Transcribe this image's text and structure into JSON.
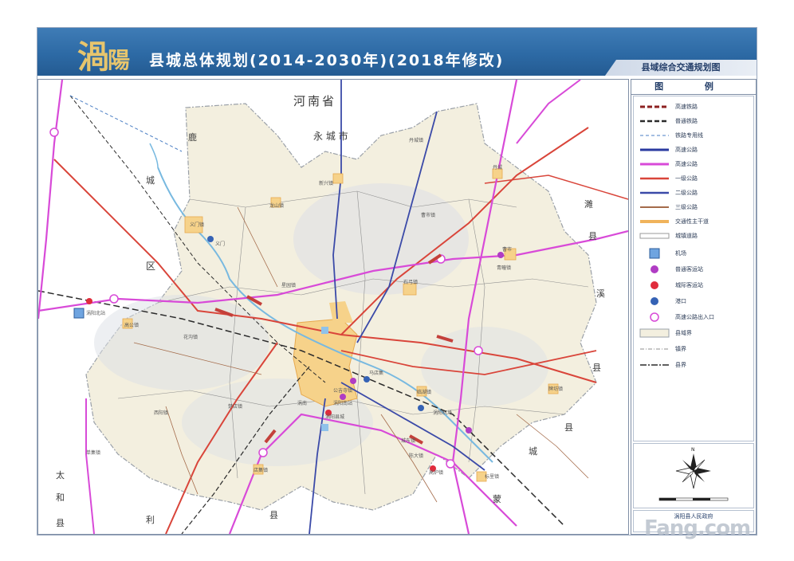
{
  "header": {
    "logo_big": "渦",
    "logo_small": "陽",
    "title": "县城总体规划(2014-2030年)(2018年修改)",
    "subtitle": "县域综合交通规划图"
  },
  "map": {
    "province_label": "河南省",
    "city_labels": {
      "yongcheng": "永 城 市",
      "left_region": "区",
      "right_region_1": "濉",
      "right_region_2": "溪",
      "right_region_3": "县",
      "bottom_left_1": "太",
      "bottom_left_2": "和",
      "bottom_left_3": "县",
      "bottom_1": "利",
      "bottom_2": "县",
      "bottom_right_1": "蒙",
      "bottom_right_2": "城",
      "bottom_right_3": "县",
      "top_left_1": "城",
      "top_left_2": "鹿",
      "top_right": "县"
    },
    "towns": {
      "t1": "丹城镇",
      "t2": "新兴镇",
      "t3": "龙山镇",
      "t4": "义门镇",
      "t5": "曹市镇",
      "t6": "青疃镇",
      "t7": "石弓镇",
      "t8": "花沟镇",
      "t9": "涡阳县城",
      "t10": "高公镇",
      "t11": "丹城",
      "t12": "临湖镇",
      "t13": "西阳镇",
      "t14": "单集镇",
      "t15": "店集镇",
      "t16": "牌坊镇",
      "t17": "标里镇",
      "t18": "公吉寺镇",
      "t19": "楚店镇",
      "t20": "陈大镇",
      "t21": "义门",
      "t22": "涡阳北站",
      "t23": "涡阳南站",
      "t24": "高炉镇",
      "t25": "曹市",
      "t26": "涡阳机场",
      "t27": "马店集",
      "t28": "城东镇",
      "t29": "星园镇",
      "t30": "涡南"
    }
  },
  "legend": {
    "title": "图 例",
    "items": [
      {
        "label": "高速铁路",
        "icon": "high-speed-rail"
      },
      {
        "label": "普通铁路",
        "icon": "rail"
      },
      {
        "label": "铁路专用线",
        "icon": "rail-spur"
      },
      {
        "label": "高速公路",
        "icon": "expressway"
      },
      {
        "label": "高速公路",
        "icon": "expressway-planned"
      },
      {
        "label": "一级公路",
        "icon": "class1-road"
      },
      {
        "label": "二级公路",
        "icon": "class2-road"
      },
      {
        "label": "三级公路",
        "icon": "class3-road"
      },
      {
        "label": "交通性主干道",
        "icon": "arterial"
      },
      {
        "label": "城镇道路",
        "icon": "town-road"
      },
      {
        "label": "机场",
        "icon": "airport-icon"
      },
      {
        "label": "普通客运站",
        "icon": "bus-station"
      },
      {
        "label": "城际客运站",
        "icon": "intercity-station"
      },
      {
        "label": "港口",
        "icon": "port-icon"
      },
      {
        "label": "高速公路出入口",
        "icon": "interchange"
      },
      {
        "label": "县域界",
        "icon": "county-boundary"
      },
      {
        "label": "镇界",
        "icon": "town-boundary"
      },
      {
        "label": "县界",
        "icon": "boundary"
      }
    ],
    "signoff": "涡阳县人民政府"
  },
  "watermark": "Fang.com",
  "colors": {
    "header_blue": "#2d6aa5",
    "logo_gold": "#e7c56d",
    "expressway": "#d84ad8",
    "class1": "#d9453a",
    "class2": "#3b4aa8",
    "rail": "#2b2b2b",
    "river": "#78b9e0",
    "county_fill": "#f3efdf",
    "urban": "#f6d28a"
  }
}
